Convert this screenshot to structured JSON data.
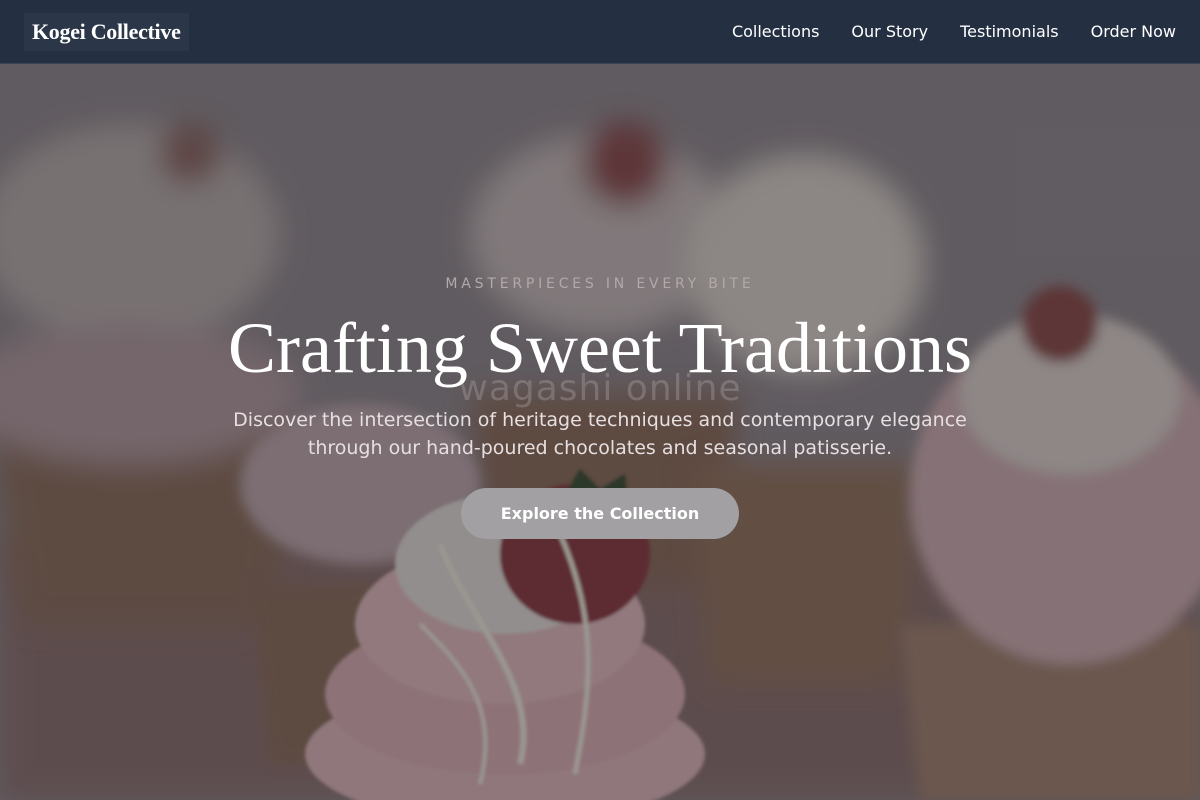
{
  "nav": {
    "brand": "Kogei Collective",
    "links": [
      {
        "label": "Collections"
      },
      {
        "label": "Our Story"
      },
      {
        "label": "Testimonials"
      },
      {
        "label": "Order Now"
      }
    ]
  },
  "hero": {
    "eyebrow": "MASTERPIECES IN EVERY BITE",
    "headline": "Crafting Sweet Traditions",
    "ghost_text": "wagashi online",
    "subtitle": "Discover the intersection of heritage techniques and contemporary elegance through our hand-poured chocolates and seasonal patisserie.",
    "cta_label": "Explore the Collection"
  },
  "colors": {
    "nav_bg": "#243042",
    "cta_bg": "#a2a0a2",
    "headline": "#ffffff"
  }
}
